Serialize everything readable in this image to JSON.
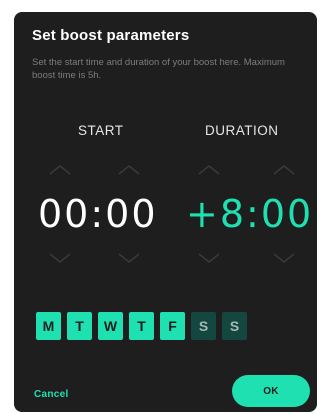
{
  "dialog": {
    "title": "Set boost parameters",
    "description": "Set the start time and duration of your boost here. Maximum boost time is 5h."
  },
  "columns": {
    "start_label": "START",
    "duration_label": "DURATION"
  },
  "time": {
    "start_value": "00:00",
    "duration_value": "+8:00"
  },
  "days": [
    {
      "label": "M",
      "active": true
    },
    {
      "label": "T",
      "active": true
    },
    {
      "label": "W",
      "active": true
    },
    {
      "label": "T",
      "active": true
    },
    {
      "label": "F",
      "active": true
    },
    {
      "label": "S",
      "active": false
    },
    {
      "label": "S",
      "active": false
    }
  ],
  "actions": {
    "cancel_label": "Cancel",
    "ok_label": "OK"
  },
  "colors": {
    "background": "#1e1e1f",
    "accent": "#1fe0b1",
    "inactive_day": "#144740"
  }
}
